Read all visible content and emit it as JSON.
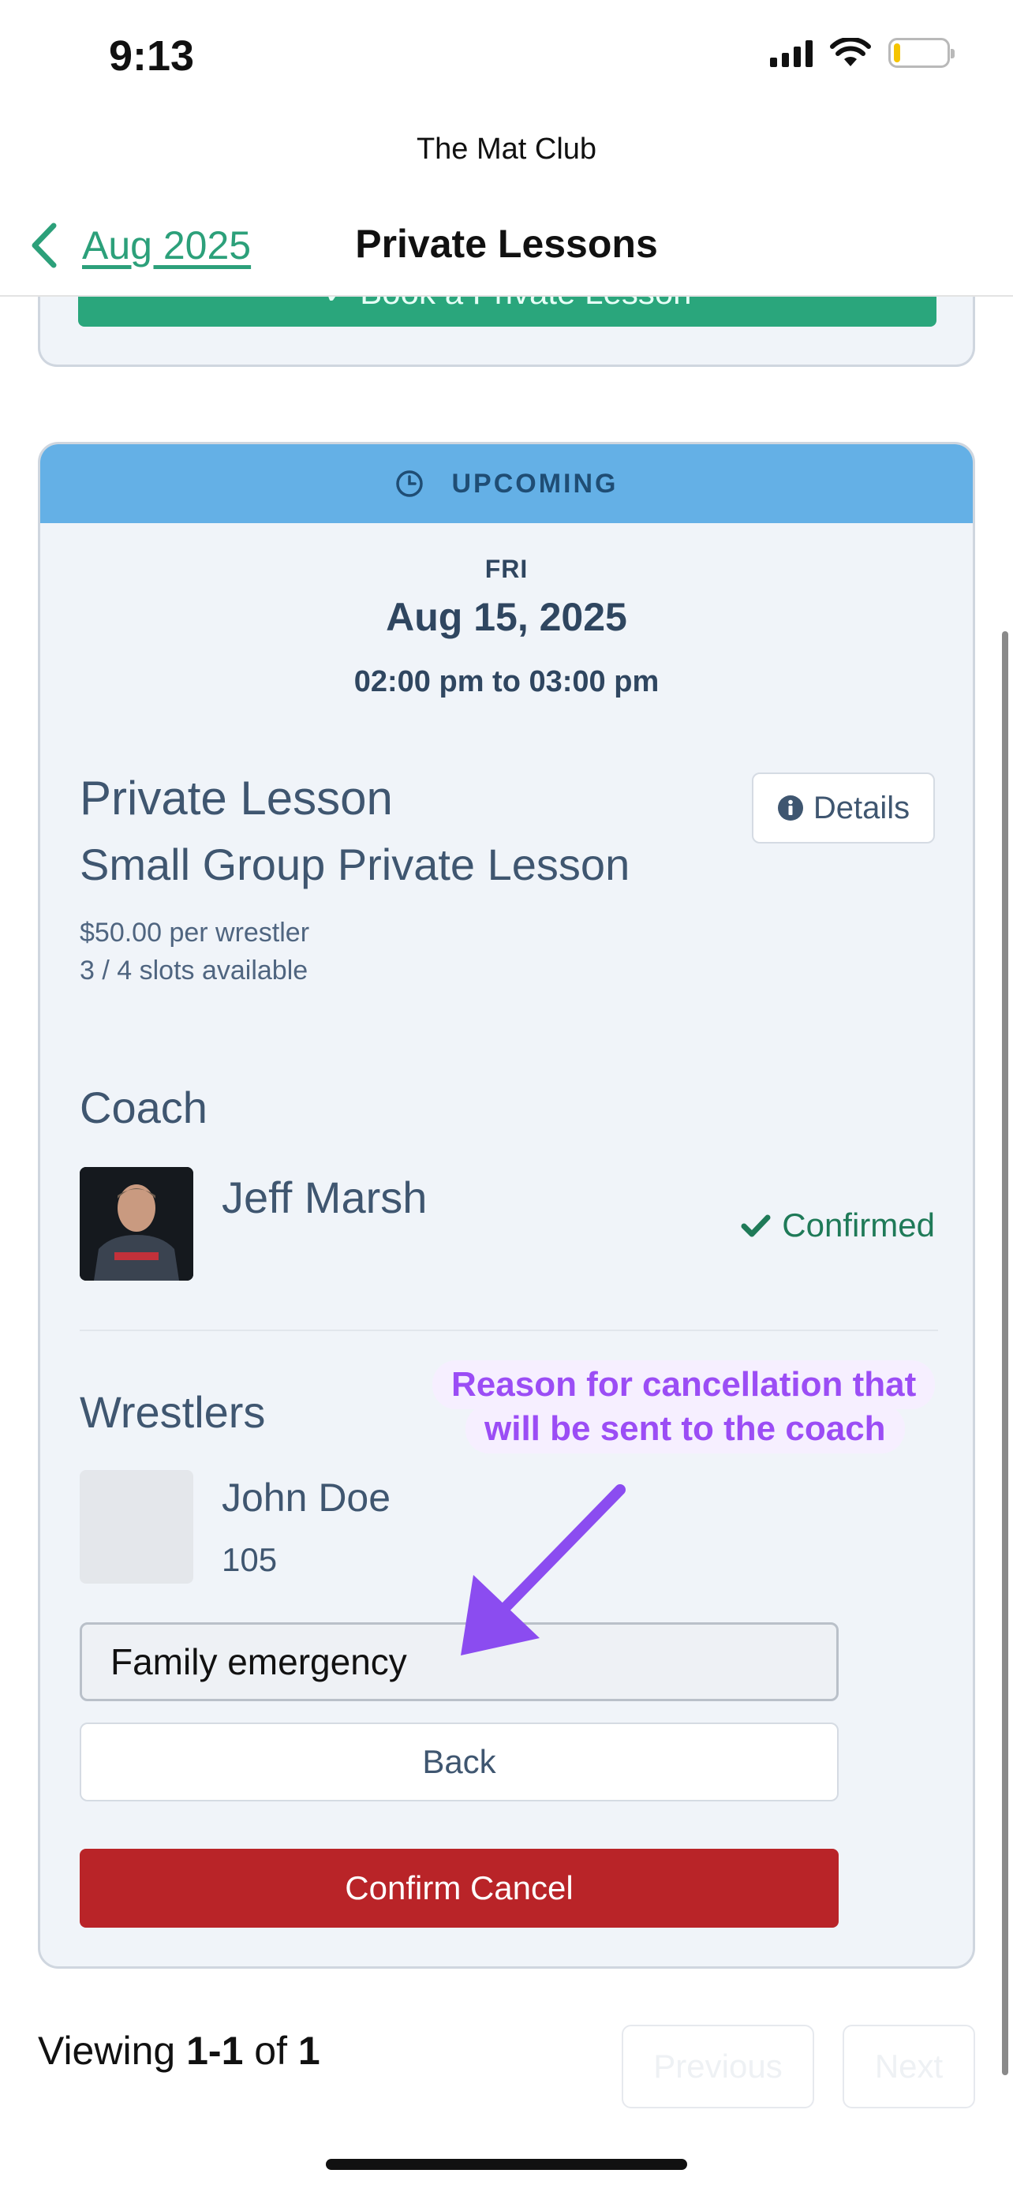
{
  "status_bar": {
    "time": "9:13"
  },
  "header": {
    "site_name": "The Mat Club",
    "back_label": "Aug 2025",
    "title": "Private Lessons"
  },
  "top_card": {
    "button_label": "✓ Book a Private Lesson"
  },
  "lesson_card": {
    "status": "UPCOMING",
    "status_color": "#64b0e6",
    "day": "FRI",
    "date": "Aug 15, 2025",
    "time_range": "02:00 pm to 03:00 pm",
    "lesson_type": "Private Lesson",
    "lesson_name": "Small Group Private Lesson",
    "details_label": "Details",
    "price": "$50.00 per wrestler",
    "slots": "3 / 4 slots available",
    "coach_heading": "Coach",
    "coach": {
      "name": "Jeff Marsh",
      "status": "Confirmed"
    },
    "wrestlers_heading": "Wrestlers",
    "wrestlers": [
      {
        "name": "John Doe",
        "weight": "105"
      }
    ],
    "cancel_reason_value": "Family emergency",
    "back_label": "Back",
    "confirm_cancel_label": "Confirm Cancel"
  },
  "annotation": {
    "line1": "Reason for cancellation that",
    "line2": "will be sent to the coach",
    "color": "#9b4df5"
  },
  "pagination": {
    "prefix": "Viewing",
    "range": "1-1",
    "of": "of",
    "total": "1",
    "previous_label": "Previous",
    "next_label": "Next"
  }
}
